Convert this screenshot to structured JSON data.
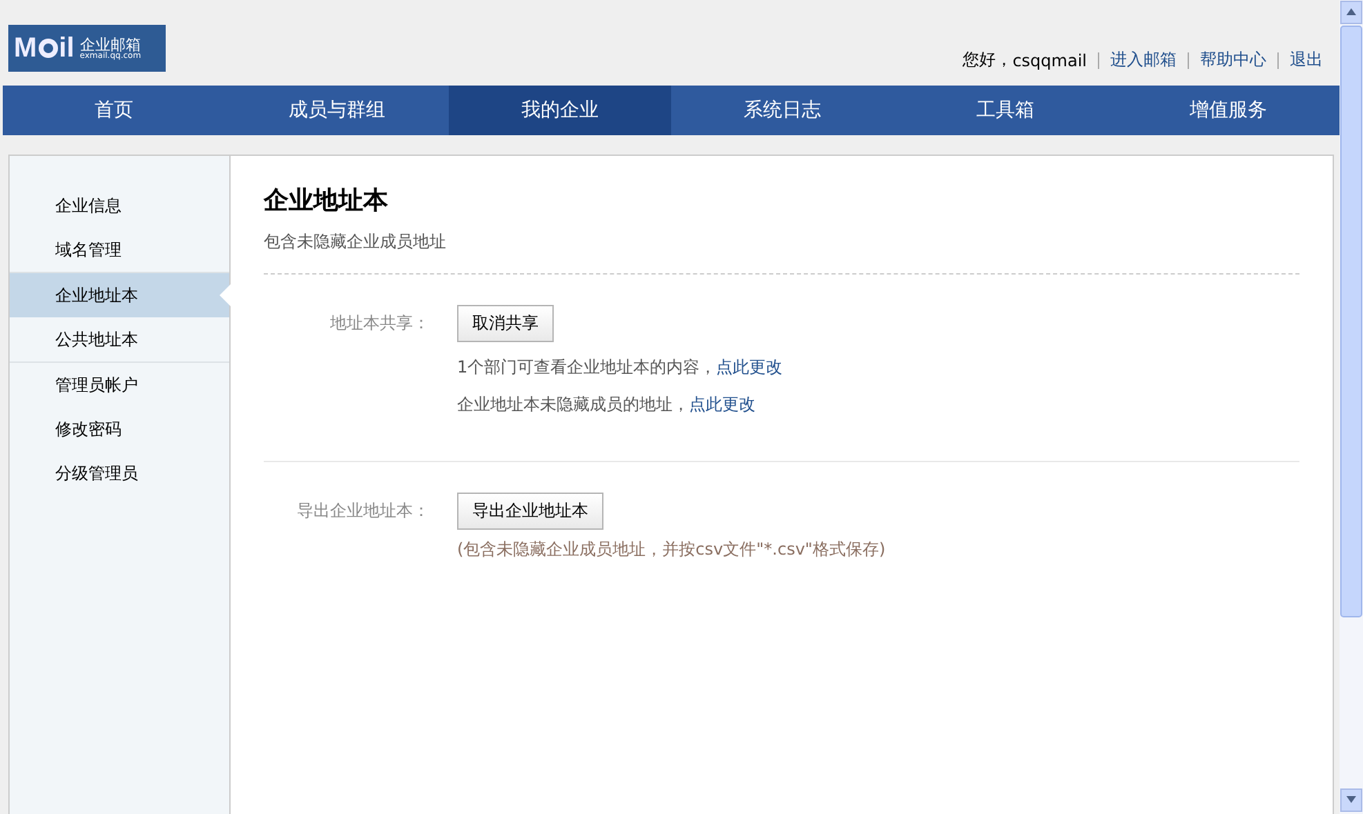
{
  "logo": {
    "mark_start": "M",
    "mark_end": "il",
    "name": "企业邮箱",
    "domain": "exmail.qq.com"
  },
  "top_links": {
    "greeting": "您好，",
    "user": "csqqmail",
    "links": [
      "进入邮箱",
      "帮助中心",
      "退出"
    ]
  },
  "nav": [
    {
      "label": "首页",
      "selected": false
    },
    {
      "label": "成员与群组",
      "selected": false
    },
    {
      "label": "我的企业",
      "selected": true
    },
    {
      "label": "系统日志",
      "selected": false
    },
    {
      "label": "工具箱",
      "selected": false
    },
    {
      "label": "增值服务",
      "selected": false
    }
  ],
  "sidebar": {
    "groups": [
      [
        {
          "label": "企业信息",
          "selected": false
        },
        {
          "label": "域名管理",
          "selected": false
        }
      ],
      [
        {
          "label": "企业地址本",
          "selected": true
        },
        {
          "label": "公共地址本",
          "selected": false
        }
      ],
      [
        {
          "label": "管理员帐户",
          "selected": false
        },
        {
          "label": "修改密码",
          "selected": false
        },
        {
          "label": "分级管理员",
          "selected": false
        }
      ]
    ]
  },
  "page": {
    "title": "企业地址本",
    "subtitle": "包含未隐藏企业成员地址"
  },
  "sections": [
    {
      "label": "地址本共享：",
      "button": "取消共享",
      "lines": [
        {
          "text": "1个部门可查看企业地址本的内容，",
          "link": "点此更改"
        },
        {
          "text": "企业地址本未隐藏成员的地址，",
          "link": "点此更改"
        }
      ]
    },
    {
      "label": "导出企业地址本：",
      "button": "导出企业地址本",
      "note": "(包含未隐藏企业成员地址，并按csv文件\"*.csv\"格式保存)"
    }
  ]
}
